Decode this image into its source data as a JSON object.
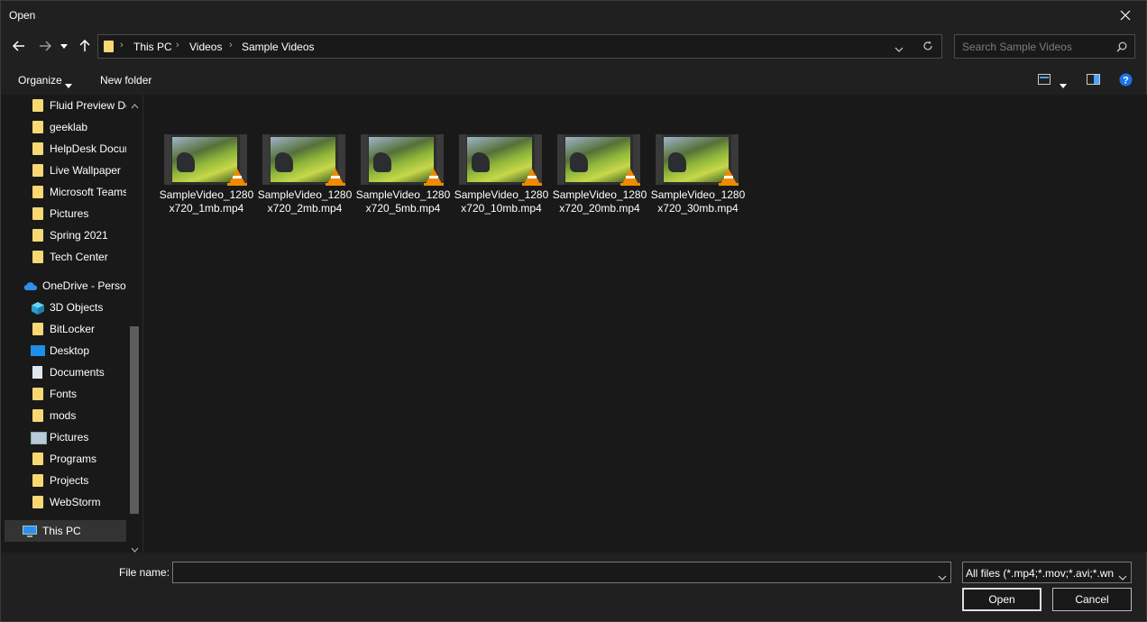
{
  "window": {
    "title": "Open"
  },
  "address": {
    "crumbs": [
      "This PC",
      "Videos",
      "Sample Videos"
    ]
  },
  "search": {
    "placeholder": "Search Sample Videos"
  },
  "toolbar": {
    "organize": "Organize",
    "new_folder": "New folder"
  },
  "sidebar": {
    "items": [
      {
        "label": "Fluid Preview Dc",
        "icon": "folder-icon"
      },
      {
        "label": "geeklab",
        "icon": "folder-icon"
      },
      {
        "label": "HelpDesk Docur",
        "icon": "shared-folder-icon"
      },
      {
        "label": "Live Wallpaper",
        "icon": "folder-icon"
      },
      {
        "label": "Microsoft Teams",
        "icon": "folder-icon"
      },
      {
        "label": "Pictures",
        "icon": "folder-icon"
      },
      {
        "label": "Spring 2021",
        "icon": "folder-icon"
      },
      {
        "label": "Tech Center",
        "icon": "folder-icon"
      },
      {
        "label": "OneDrive - Persor",
        "icon": "onedrive-cloud-icon"
      },
      {
        "label": "3D Objects",
        "icon": "3d-objects-icon"
      },
      {
        "label": "BitLocker",
        "icon": "folder-icon"
      },
      {
        "label": "Desktop",
        "icon": "desktop-icon"
      },
      {
        "label": "Documents",
        "icon": "documents-icon"
      },
      {
        "label": "Fonts",
        "icon": "folder-icon"
      },
      {
        "label": "mods",
        "icon": "folder-icon"
      },
      {
        "label": "Pictures",
        "icon": "pictures-icon"
      },
      {
        "label": "Programs",
        "icon": "folder-icon"
      },
      {
        "label": "Projects",
        "icon": "folder-icon"
      },
      {
        "label": "WebStorm",
        "icon": "folder-icon"
      },
      {
        "label": "This PC",
        "icon": "this-pc-icon"
      }
    ]
  },
  "files": [
    {
      "name": "SampleVideo_1280x720_1mb.mp4"
    },
    {
      "name": "SampleVideo_1280x720_2mb.mp4"
    },
    {
      "name": "SampleVideo_1280x720_5mb.mp4"
    },
    {
      "name": "SampleVideo_1280x720_10mb.mp4"
    },
    {
      "name": "SampleVideo_1280x720_20mb.mp4"
    },
    {
      "name": "SampleVideo_1280x720_30mb.mp4"
    }
  ],
  "footer": {
    "file_name_label": "File name:",
    "file_name_value": "",
    "filter": "All files (*.mp4;*.mov;*.avi;*.wn",
    "open": "Open",
    "cancel": "Cancel"
  },
  "colors": {
    "folder": "#f8d775",
    "vlc_cone": "#f08a00",
    "help": "#1a73e8"
  }
}
